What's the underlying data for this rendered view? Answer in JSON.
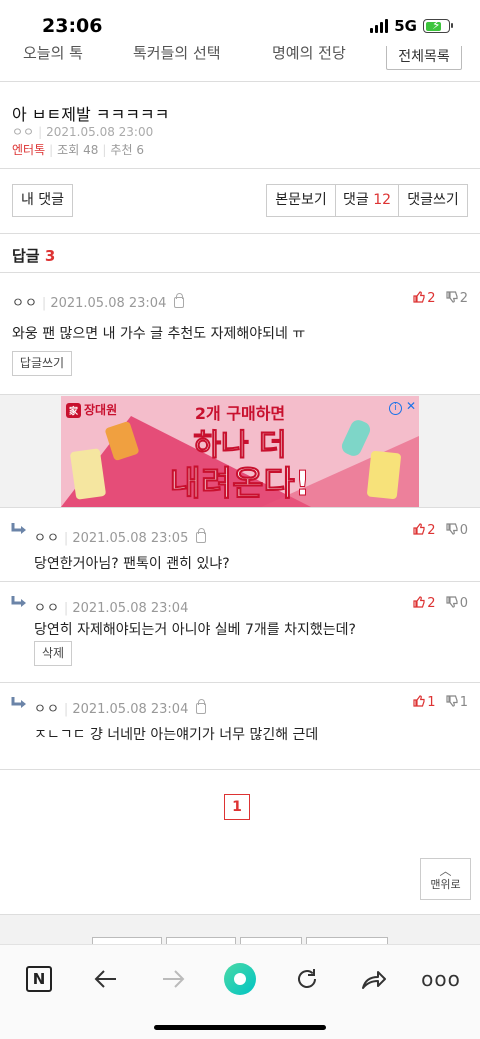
{
  "status_bar": {
    "time": "23:06",
    "network": "5G"
  },
  "top_nav": {
    "items": [
      "오늘의 톡",
      "톡커들의 선택",
      "명예의 전당"
    ],
    "all_label": "전체목록"
  },
  "post": {
    "title": "아 ㅂㅌ제발 ㅋㅋㅋㅋㅋ",
    "author": "ㅇㅇ",
    "datetime": "2021.05.08 23:00",
    "category": "엔터톡",
    "views_label": "조회",
    "views": "48",
    "recommend_label": "추천",
    "recommend": "6"
  },
  "buttons": {
    "my_comments": "내 댓글",
    "view_post": "본문보기",
    "comments_label": "댓글",
    "comments_count": "12",
    "write_comment": "댓글쓰기"
  },
  "replies": {
    "label": "답글",
    "count": "3"
  },
  "comments": [
    {
      "author": "ㅇㅇ",
      "datetime": "2021.05.08 23:04",
      "text": "와웅 팬 많으면 내 가수 글 추천도 자제해야되네 ㅠ",
      "up": "2",
      "down": "2",
      "action": "답글쓰기"
    },
    {
      "author": "ㅇㅇ",
      "datetime": "2021.05.08 23:05",
      "text": "당연한거아님? 팬톡이 괜히 있냐?",
      "up": "2",
      "down": "0"
    },
    {
      "author": "ㅇㅇ",
      "datetime": "2021.05.08 23:04",
      "text": "당연히 자제해야되는거 아니야 실베 7개를 차지했는데?",
      "up": "2",
      "down": "0",
      "action": "삭제"
    },
    {
      "author": "ㅇㅇ",
      "datetime": "2021.05.08 23:04",
      "text": "ㅈㄴㄱㄷ 걍 너네만 아는얘기가 너무 많긴해 근데",
      "up": "1",
      "down": "1"
    }
  ],
  "ad": {
    "brand": "장대원",
    "line1": "2개 구매하면",
    "line2": "하나 더",
    "line3": "내려온다!",
    "close": "✕",
    "info": "i"
  },
  "pagination": {
    "current": "1"
  },
  "to_top": {
    "label": "맨위로"
  },
  "browser_bar": {
    "icons": [
      "naver-n-icon",
      "back-icon",
      "forward-icon",
      "home-green-icon",
      "refresh-icon",
      "share-icon",
      "more-icon"
    ],
    "n_letter": "N",
    "more": "ooo"
  }
}
